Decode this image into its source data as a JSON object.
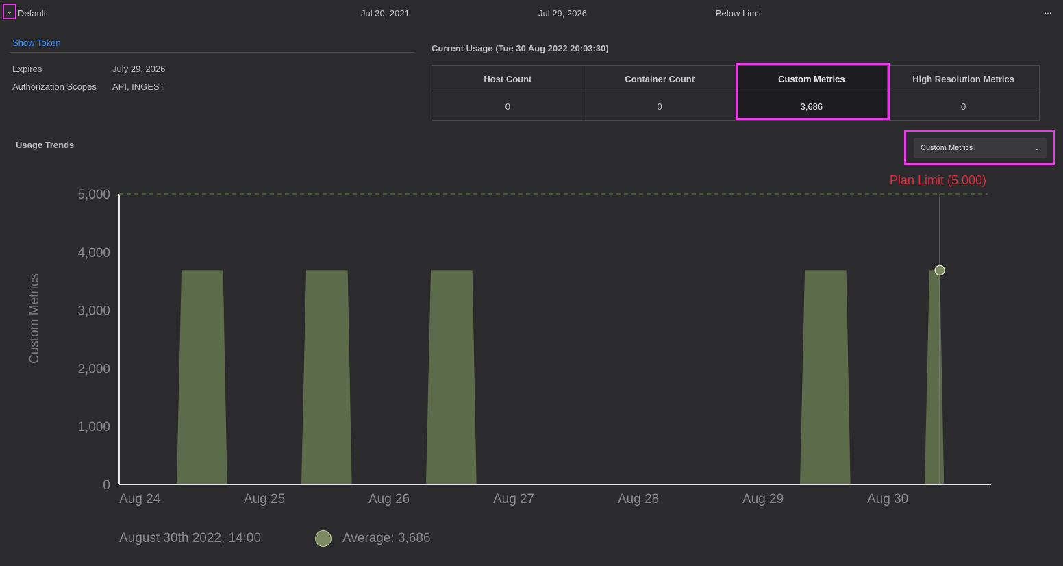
{
  "token": {
    "name": "Default",
    "created": "Jul 30, 2021",
    "expires_short": "Jul 29, 2026",
    "status": "Below Limit",
    "more_label": "···",
    "show_token_label": "Show Token",
    "details": [
      {
        "key": "Expires",
        "value": "July 29, 2026"
      },
      {
        "key": "Authorization Scopes",
        "value": "API, INGEST"
      }
    ]
  },
  "current_usage": {
    "title": "Current Usage (Tue 30 Aug 2022 20:03:30)",
    "columns": [
      "Host Count",
      "Container Count",
      "Custom Metrics",
      "High Resolution Metrics"
    ],
    "values": [
      "0",
      "0",
      "3,686",
      "0"
    ]
  },
  "trends": {
    "title": "Usage Trends",
    "selector_value": "Custom Metrics"
  },
  "legend": {
    "timestamp": "August 30th 2022, 14:00",
    "average": "Average: 3,686"
  },
  "colors": {
    "series": "#5c6b4a",
    "plan_limit": "#e8243c",
    "highlight": "#e63ce6",
    "link": "#3d8cf0"
  },
  "chart_data": {
    "type": "area",
    "ylabel": "Custom Metrics",
    "ylim": [
      0,
      5000
    ],
    "yticks": [
      "0",
      "1,000",
      "2,000",
      "3,000",
      "4,000",
      "5,000"
    ],
    "yticks_values": [
      0,
      1000,
      2000,
      3000,
      4000,
      5000
    ],
    "x_tick_labels": [
      "Aug 24",
      "Aug 25",
      "Aug 26",
      "Aug 27",
      "Aug 28",
      "Aug 29",
      "Aug 30"
    ],
    "plan_limit": 5000,
    "plan_limit_label": "Plan Limit (5,000)",
    "series": [
      {
        "values": [
          {
            "start": "Aug 24 12:00",
            "end": "Aug 24 20:00",
            "value": 3686
          },
          {
            "start": "Aug 25 12:00",
            "end": "Aug 25 20:00",
            "value": 3686
          },
          {
            "start": "Aug 26 12:00",
            "end": "Aug 26 20:00",
            "value": 3686
          },
          {
            "start": "Aug 29 12:00",
            "end": "Aug 29 20:00",
            "value": 3686
          },
          {
            "start": "Aug 30 12:00",
            "end": "Aug 30 14:00",
            "value": 3686
          }
        ]
      }
    ],
    "hover_point": {
      "x": "Aug 30 14:00",
      "value": 3686
    }
  }
}
